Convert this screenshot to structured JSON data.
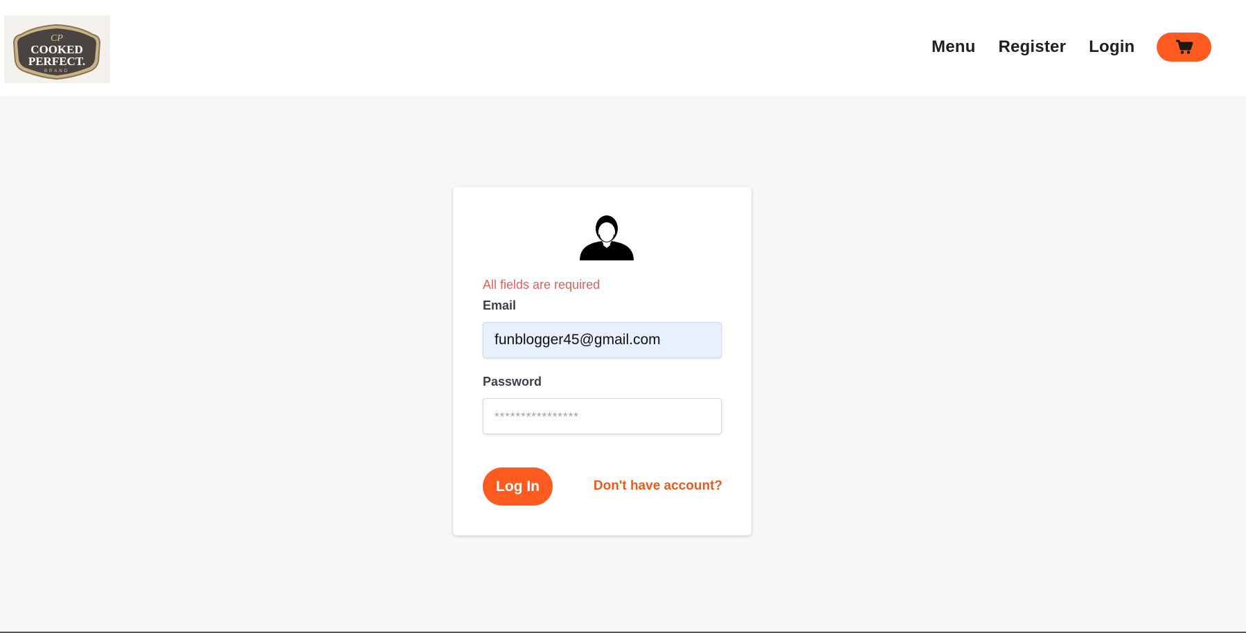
{
  "brand": {
    "logo_line1": "COOKED",
    "logo_line2": "PERFECT.",
    "logo_line3": "BRAND"
  },
  "nav": {
    "items": [
      {
        "label": "Menu"
      },
      {
        "label": "Register"
      },
      {
        "label": "Login"
      }
    ],
    "cart_icon": "shopping-cart-icon",
    "accent_color": "#ff5a1f"
  },
  "login_form": {
    "avatar_icon": "user-avatar-icon",
    "error_message": "All fields are required",
    "email_label": "Email",
    "email_value": "funblogger45@gmail.com",
    "password_label": "Password",
    "password_placeholder": "****************",
    "submit_label": "Log In",
    "register_link": "Don't have account?",
    "error_color": "#e0605a"
  }
}
